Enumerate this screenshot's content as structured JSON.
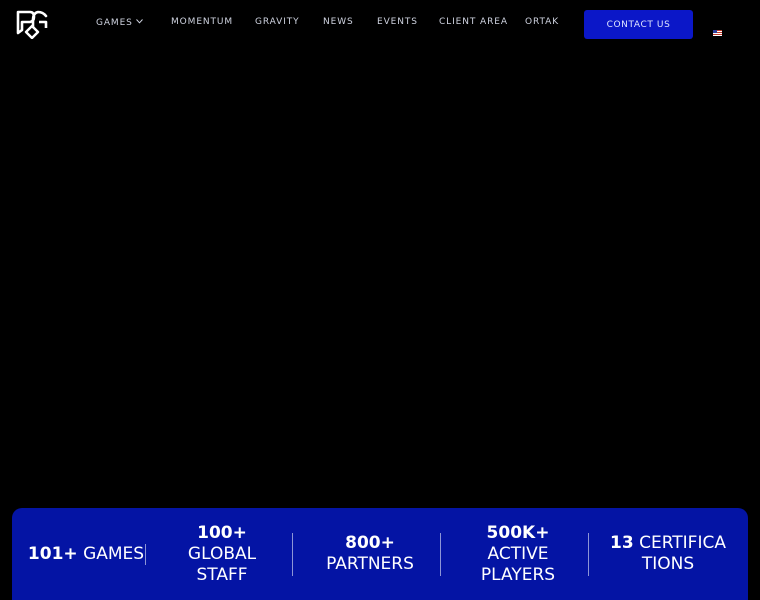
{
  "nav": {
    "items": [
      {
        "label": "GAMES",
        "has_dropdown": true
      },
      {
        "label": "MOMENTUM"
      },
      {
        "label": "GRAVITY"
      },
      {
        "label": "NEWS"
      },
      {
        "label": "EVENTS"
      },
      {
        "label": "CLIENT AREA"
      },
      {
        "label": "ORTAK"
      }
    ],
    "contact_label": "CONTACT US",
    "language_icon": "us-flag-icon",
    "logo_icon": "pg-logo-icon"
  },
  "stats": [
    {
      "value": "101+",
      "label": "GAMES"
    },
    {
      "value": "100+",
      "label": "GLOBAL STAFF"
    },
    {
      "value": "800+",
      "label": "PARTNERS"
    },
    {
      "value": "500K+",
      "label": "ACTIVE PLAYERS"
    },
    {
      "value": "13",
      "label": "CERTIFICATIONS"
    }
  ],
  "colors": {
    "background": "#000000",
    "accent": "#0b17c8",
    "stats_bar": "#0414a4"
  }
}
